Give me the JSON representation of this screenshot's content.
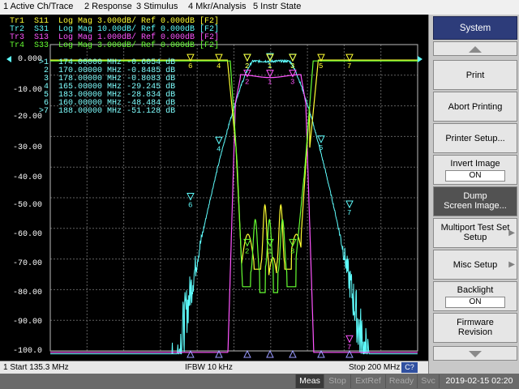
{
  "menu": [
    "1 Active Ch/Trace",
    "2 Response",
    "3 Stimulus",
    "4 Mkr/Analysis",
    "5 Instr State"
  ],
  "traces": [
    {
      "id": "Tr1",
      "text": "Tr1  S11  Log Mag 3.000dB/ Ref 0.000dB [F2]",
      "color": "#ffff33"
    },
    {
      "id": "Tr2",
      "text": "Tr2  S31  Log Mag 10.00dB/ Ref 0.000dB [F2]",
      "color": "#5fffff"
    },
    {
      "id": "Tr3",
      "text": "Tr3  S13  Log Mag 1.000dB/ Ref 0.000dB [F2]",
      "color": "#ff55ff"
    },
    {
      "id": "Tr4",
      "text": "Tr4  S33  Log Mag 3.000dB/ Ref 0.000dB [F2]",
      "color": "#66ff33"
    }
  ],
  "yaxis": [
    "0.000",
    "-10.00",
    "-20.00",
    "-30.00",
    "-40.00",
    "-50.00",
    "-60.00",
    "-70.00",
    "-80.00",
    "-90.00",
    "-100.0"
  ],
  "markers": [
    {
      "no": ">1",
      "freq": "174.00000 MHz",
      "val": "-0.6054 dB"
    },
    {
      "no": " 2",
      "freq": "170.00000 MHz",
      "val": "-0.8485 dB"
    },
    {
      "no": " 3",
      "freq": "178.00000 MHz",
      "val": "-0.8083 dB"
    },
    {
      "no": " 4",
      "freq": "165.00000 MHz",
      "val": "-29.245 dB"
    },
    {
      "no": " 5",
      "freq": "183.00000 MHz",
      "val": "-28.834 dB"
    },
    {
      "no": " 6",
      "freq": "160.00000 MHz",
      "val": "-48.484 dB"
    },
    {
      "no": ">7",
      "freq": "188.00000 MHz",
      "val": "-51.128 dB"
    }
  ],
  "status": {
    "start": "1  Start 135.3 MHz",
    "ifbw": "IFBW 10 kHz",
    "stop": "Stop 200 MHz",
    "c": "C?"
  },
  "bottom": {
    "meas": "Meas",
    "stop": "Stop",
    "extref": "ExtRef",
    "ready": "Ready",
    "svc": "Svc",
    "datetime": "2019-02-15 02:20"
  },
  "softkeys": {
    "title": "System",
    "print": "Print",
    "abort": "Abort Printing",
    "printer_setup": "Printer Setup...",
    "invert_image": "Invert Image",
    "invert_val": "ON",
    "dump1": "Dump",
    "dump2": "Screen Image...",
    "multiport1": "Multiport Test Set",
    "multiport2": "Setup",
    "misc": "Misc Setup",
    "backlight": "Backlight",
    "backlight_val": "ON",
    "firmware1": "Firmware",
    "firmware2": "Revision"
  },
  "colors": {
    "s11": "#ffff33",
    "s31": "#5fffff",
    "s13": "#ff55ff",
    "s33": "#66ff33",
    "softkey_title": "#2d3c7a"
  }
}
